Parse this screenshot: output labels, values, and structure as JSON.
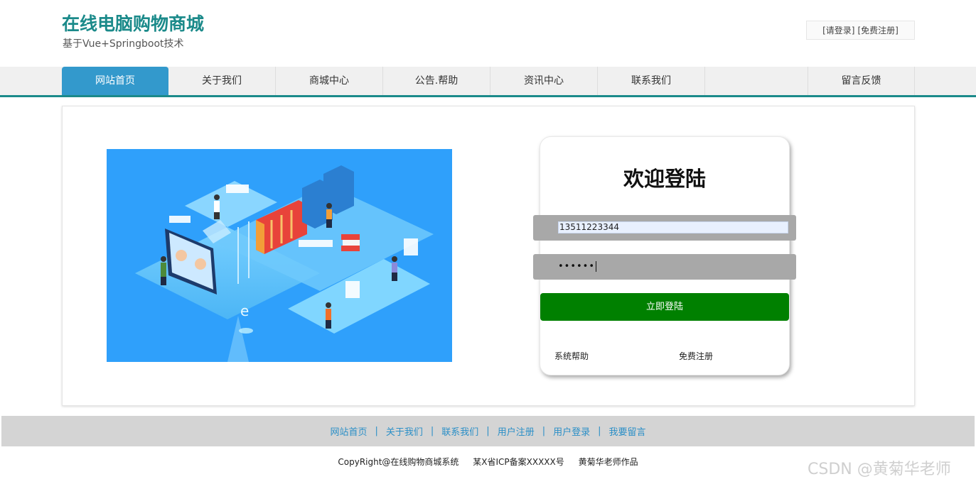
{
  "header": {
    "title": "在线电脑购物商城",
    "subtitle": "基于Vue+Springboot技术",
    "login_link": "[请登录]",
    "register_link": "[免费注册]"
  },
  "nav": {
    "items": [
      {
        "label": "网站首页"
      },
      {
        "label": "关于我们"
      },
      {
        "label": "商城中心"
      },
      {
        "label": "公告.帮助"
      },
      {
        "label": "资讯中心"
      },
      {
        "label": "联系我们"
      },
      {
        "label": "留言反馈"
      }
    ],
    "active": "网站首页"
  },
  "login": {
    "title": "欢迎登陆",
    "username_value": "13511223344",
    "password_masked": "••••••",
    "submit_label": "立即登陆",
    "help_link": "系统帮助",
    "register_link": "免费注册"
  },
  "footer": {
    "links": [
      "网站首页",
      "关于我们",
      "联系我们",
      "用户注册",
      "用户登录",
      "我要留言"
    ],
    "copyright": "CopyRight@在线购物商城系统",
    "icp": "某X省ICP备案XXXXX号",
    "author": "黄菊华老师作品"
  },
  "watermark": "CSDN @黄菊华老师",
  "colors": {
    "brand_teal": "#1b8a8a",
    "nav_active": "#3399cc",
    "login_button": "#008000",
    "footer_link": "#2b8fc7",
    "illustration_bg": "#2fa0fb"
  },
  "illustration": {
    "icon": "isometric-office-illustration"
  }
}
